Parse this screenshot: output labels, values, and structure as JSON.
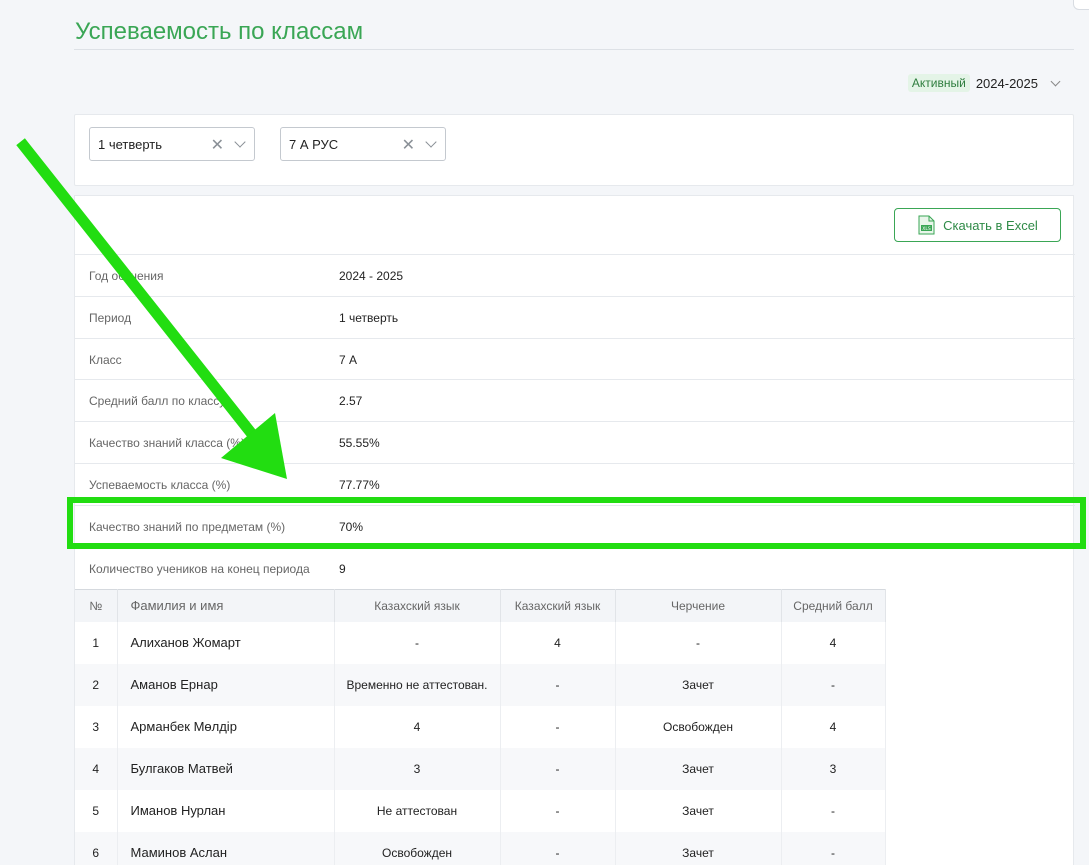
{
  "header": {
    "title": "Успеваемость по классам",
    "status_badge": "Активный",
    "year": "2024-2025"
  },
  "filters": {
    "period": "1 четверть",
    "class": "7 А РУС"
  },
  "actions": {
    "excel_label": "Скачать в Excel",
    "excel_icon_text": "XLS"
  },
  "info": {
    "rows": [
      {
        "label": "Год обучения",
        "value": "2024 - 2025"
      },
      {
        "label": "Период",
        "value": "1 четверть"
      },
      {
        "label": "Класс",
        "value": "7 А"
      },
      {
        "label": "Средний балл по классу",
        "value": "2.57"
      },
      {
        "label": "Качество знаний класса (%)",
        "value": "55.55%"
      },
      {
        "label": "Успеваемость класса (%)",
        "value": "77.77%"
      },
      {
        "label": "Качество знаний по предметам (%)",
        "value": "70%"
      },
      {
        "label": "Количество учеников на конец периода",
        "value": "9"
      }
    ]
  },
  "table": {
    "headers": [
      "№",
      "Фамилия и имя",
      "Казахский язык",
      "Казахский язык",
      "Черчение",
      "Средний балл"
    ],
    "rows": [
      [
        "1",
        "Алиханов Жомарт",
        "-",
        "4",
        "-",
        "4"
      ],
      [
        "2",
        "Аманов Ернар",
        "Временно не аттестован.",
        "-",
        "Зачет",
        "-"
      ],
      [
        "3",
        "Арманбек Мөлдір",
        "4",
        "-",
        "Освобожден",
        "4"
      ],
      [
        "4",
        "Булгаков Матвей",
        "3",
        "-",
        "Зачет",
        "3"
      ],
      [
        "5",
        "Иманов Нурлан",
        "Не аттестован",
        "-",
        "Зачет",
        "-"
      ],
      [
        "6",
        "Маминов Аслан",
        "Освобожден",
        "-",
        "Зачет",
        "-"
      ]
    ]
  },
  "colors": {
    "accent": "#3aa655",
    "annotation": "#22dd11"
  }
}
